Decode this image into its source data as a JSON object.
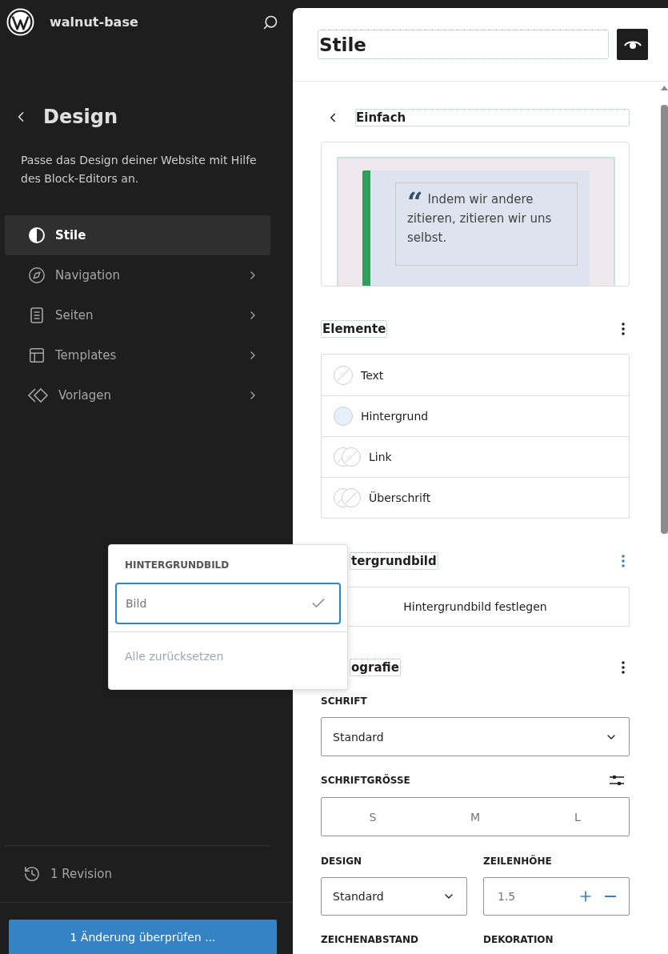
{
  "sidebar": {
    "site_title": "walnut-base",
    "section_title": "Design",
    "description": "Passe das Design deiner Website mit Hilfe des Block-Editors an.",
    "nav_items": [
      {
        "label": "Stile",
        "selected": true,
        "has_submenu": false
      },
      {
        "label": "Navigation",
        "selected": false,
        "has_submenu": true
      },
      {
        "label": "Seiten",
        "selected": false,
        "has_submenu": true
      },
      {
        "label": "Templates",
        "selected": false,
        "has_submenu": true
      },
      {
        "label": "Vorlagen",
        "selected": false,
        "has_submenu": true
      }
    ],
    "revision": "1 Revision",
    "review_button": "1 Änderung überprüfen ..."
  },
  "panel": {
    "title": "Stile",
    "subtitle": "Einfach",
    "preview_quote_mark": "“",
    "preview_quote": "Indem wir andere zitieren, zitieren wir uns selbst.",
    "elements": {
      "heading": "Elemente",
      "menu_active": false,
      "items": [
        {
          "label": "Text",
          "kind": "single"
        },
        {
          "label": "Hintergrund",
          "kind": "single",
          "color": "#e6f0fb"
        },
        {
          "label": "Link",
          "kind": "double"
        },
        {
          "label": "Überschrift",
          "kind": "double"
        }
      ]
    },
    "background_image": {
      "heading": "tergrundbild",
      "menu_active": true,
      "button": "Hintergrundbild festlegen"
    },
    "typography": {
      "heading": "ografie",
      "menu_active": false,
      "font_label": "SCHRIFT",
      "font_value": "Standard",
      "size_label": "SCHRIFTGRÖSSE",
      "sizes": [
        {
          "label": "S",
          "selected": false
        },
        {
          "label": "M",
          "selected": false
        },
        {
          "label": "L",
          "selected": false
        }
      ],
      "design_label": "DESIGN",
      "design_value": "Standard",
      "line_height_label": "ZEILENHÖHE",
      "line_height_value": "1.5",
      "letter_spacing_label": "ZEICHENABSTAND",
      "decoration_label": "DEKORATION"
    }
  },
  "popover": {
    "heading": "HINTERGRUNDBILD",
    "items": [
      {
        "label": "Bild",
        "checked": true
      }
    ],
    "reset": {
      "label": "Alle zurücksetzen",
      "disabled": true
    }
  }
}
